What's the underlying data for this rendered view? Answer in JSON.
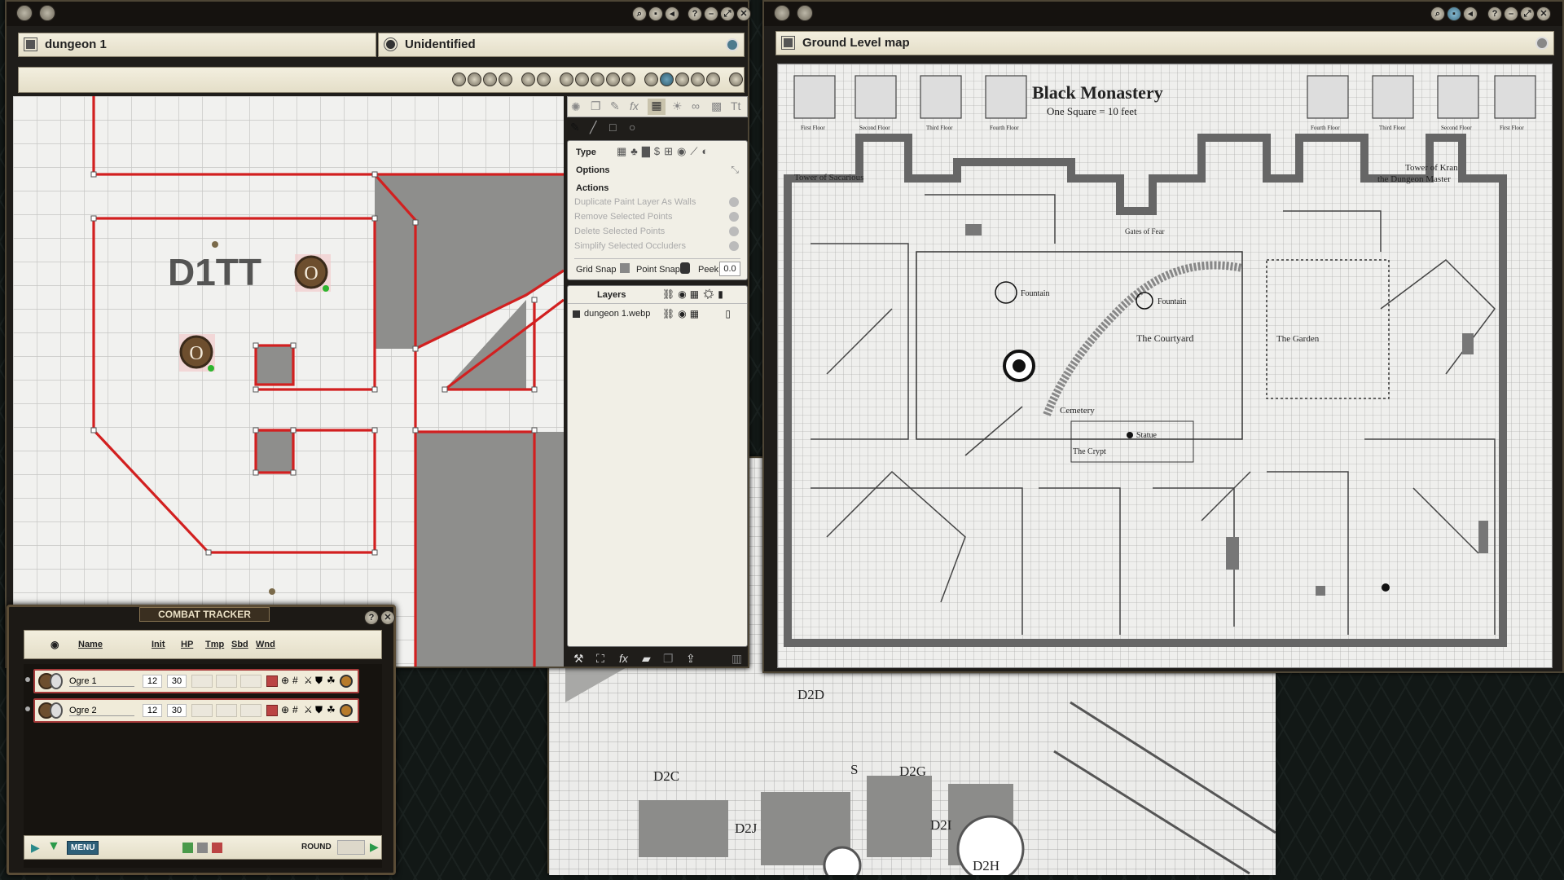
{
  "left_window": {
    "map_name": "dungeon 1",
    "identity": "Unidentified",
    "map_label": "D1TT",
    "token_label": "O"
  },
  "properties_panel": {
    "type_label": "Type",
    "options_label": "Options",
    "actions_label": "Actions",
    "actions": [
      "Duplicate Paint Layer As Walls",
      "Remove Selected Points",
      "Delete Selected Points",
      "Simplify Selected Occluders"
    ],
    "grid_snap_label": "Grid Snap",
    "point_snap_label": "Point Snap",
    "peek_label": "Peek",
    "peek_value": "0.0",
    "layers_title": "Layers",
    "layers": [
      {
        "name": "dungeon 1.webp"
      }
    ]
  },
  "combat_tracker": {
    "title": "COMBAT TRACKER",
    "columns": {
      "name": "Name",
      "init": "Init",
      "hp": "HP",
      "tmp": "Tmp",
      "sbd": "Sbd",
      "wnd": "Wnd"
    },
    "rows": [
      {
        "name": "Ogre 1",
        "init": "12",
        "hp": "30"
      },
      {
        "name": "Ogre 2",
        "init": "12",
        "hp": "30"
      }
    ],
    "menu_label": "MENU",
    "round_label": "ROUND"
  },
  "right_window": {
    "title": "Ground Level map",
    "map_title": "Black Monastery",
    "map_scale": "One Square = 10 feet",
    "labels": {
      "tower_left": "Tower of Sacarious",
      "tower_right_1": "Tower of Kran",
      "tower_right_2": "the Dungeon Master",
      "courtyard": "The Courtyard",
      "garden": "The Garden",
      "fountain": "Fountain",
      "cemetery": "Cemetery",
      "crypt": "The Crypt",
      "statue": "Statue",
      "gates": "Gates of Fear",
      "first_floor": "First Floor",
      "second_floor": "Second Floor",
      "third_floor": "Third Floor",
      "fourth_floor": "Fourth Floor"
    }
  },
  "bottom_map": {
    "labels": [
      "D2D",
      "D2C",
      "D2G",
      "D2J",
      "D2I",
      "D2H",
      "S"
    ]
  }
}
